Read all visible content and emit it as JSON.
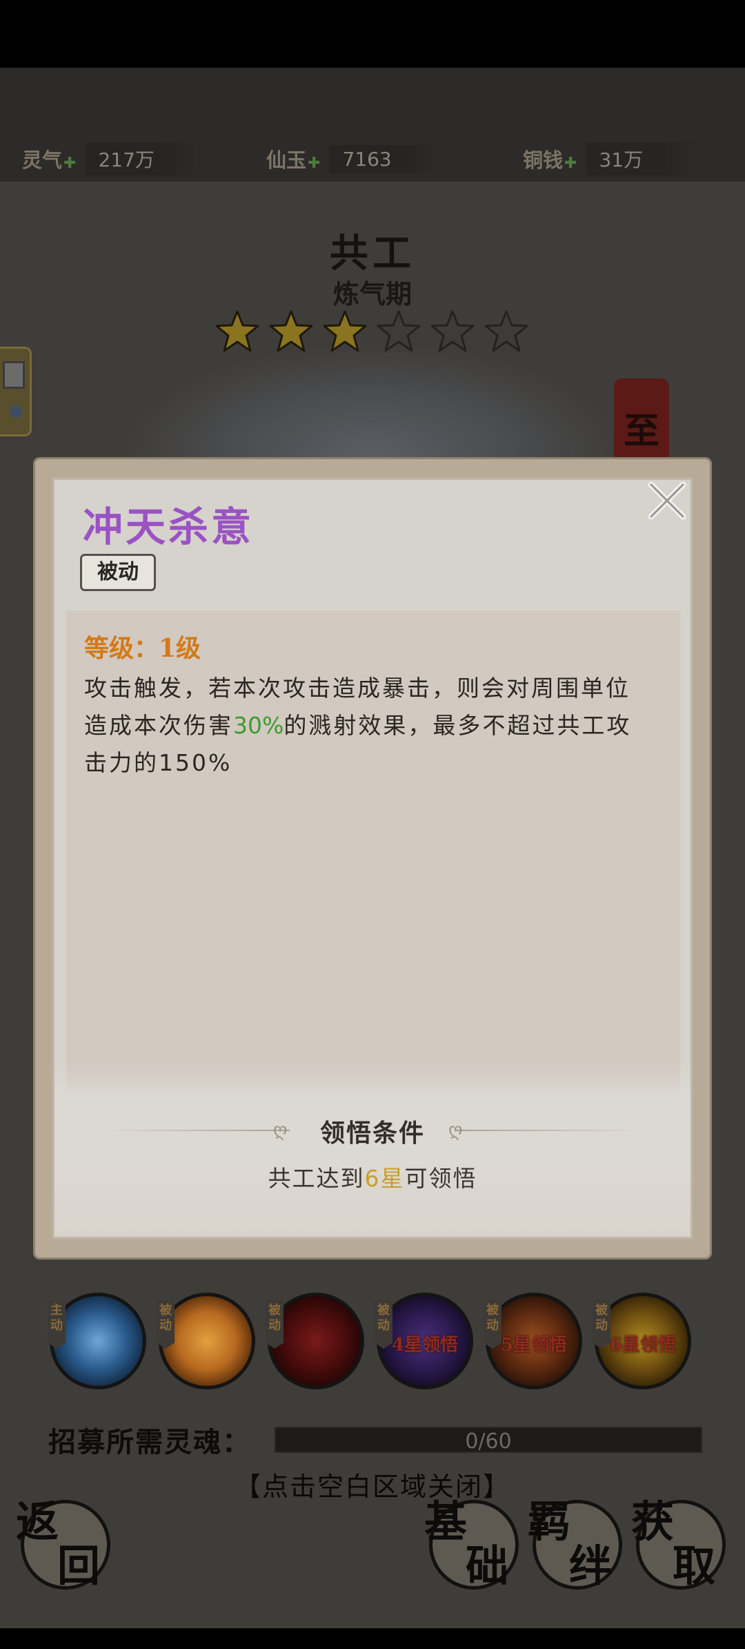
{
  "resources": [
    {
      "label": "灵气",
      "value": "217万"
    },
    {
      "label": "仙玉",
      "value": "7163"
    },
    {
      "label": "铜钱",
      "value": "31万"
    }
  ],
  "hero": {
    "name": "共工",
    "rank": "炼气期",
    "stars_filled": 3,
    "stars_total": 6,
    "seal_char": "至"
  },
  "modal": {
    "title": "冲天杀意",
    "type_badge": "被动",
    "level": "等级：1级",
    "desc_1": "攻击触发，若本次攻击造成暴击，则会对周围单位造成本次伤害",
    "desc_hl": "30%",
    "desc_2": "的溅射效果，最多不超过共工攻击力的150%",
    "condition_title": "领悟条件",
    "condition_pre": "共工达到",
    "condition_star": "6星",
    "condition_post": "可领悟"
  },
  "skills": [
    {
      "tag": "主动",
      "lock": ""
    },
    {
      "tag": "被动",
      "lock": ""
    },
    {
      "tag": "被动",
      "lock": ""
    },
    {
      "tag": "被动",
      "lock": "4星领悟"
    },
    {
      "tag": "被动",
      "lock": "5星领悟"
    },
    {
      "tag": "被动",
      "lock": "6星领悟"
    }
  ],
  "recruit": {
    "label": "招募所需灵魂：",
    "progress_text": "0/60",
    "progress": 0
  },
  "close_hint": "【点击空白区域关闭】",
  "buttons": {
    "back": [
      "返",
      "回"
    ],
    "basic": [
      "基",
      "础"
    ],
    "bond": [
      "羁",
      "绊"
    ],
    "obtain": [
      "获",
      "取"
    ]
  },
  "colors": {
    "title_purple": "#9a52c4",
    "level_orange": "#d27a18",
    "highlight_green": "#3c9b2e",
    "star_gold": "#c8a02a"
  }
}
